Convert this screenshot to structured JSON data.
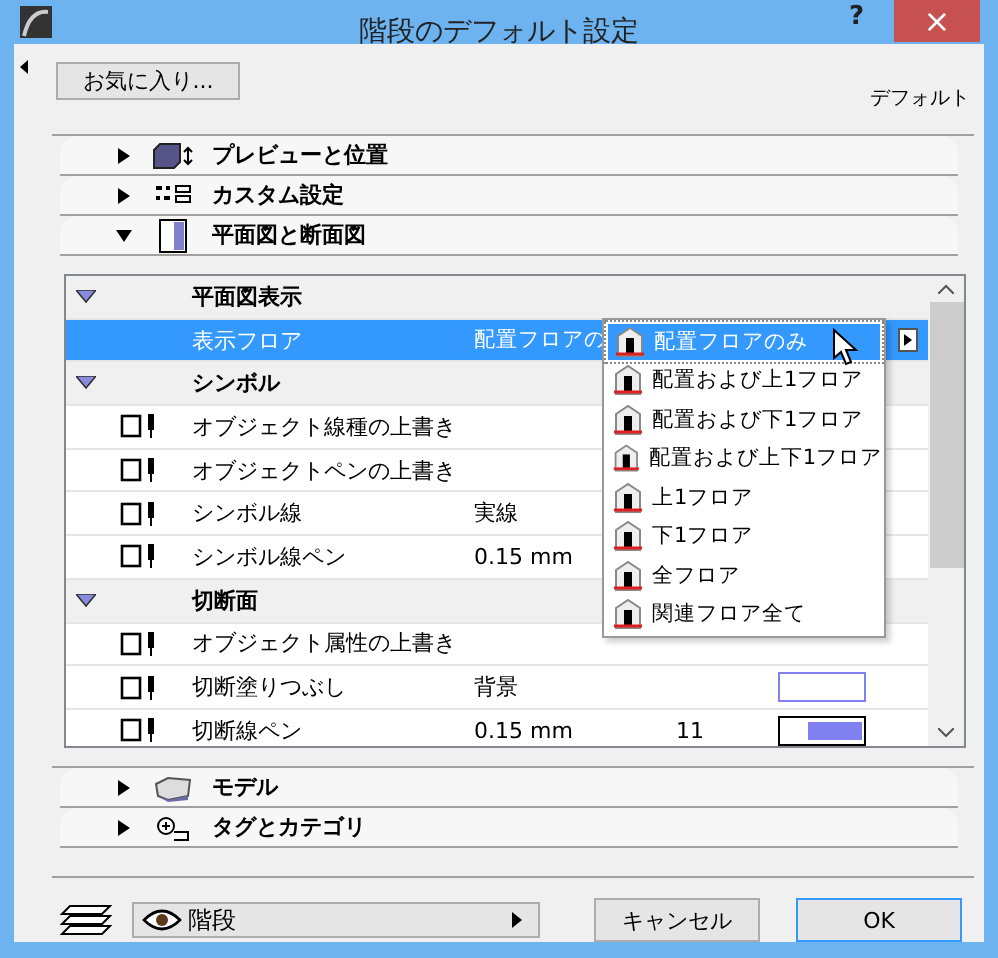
{
  "window": {
    "title": "階段のデフォルト設定",
    "help": "?",
    "close": "×"
  },
  "favorites_button": "お気に入り...",
  "default_label": "デフォルト",
  "sections": [
    {
      "label": "プレビューと位置",
      "expanded": false
    },
    {
      "label": "カスタム設定",
      "expanded": false
    },
    {
      "label": "平面図と断面図",
      "expanded": true
    }
  ],
  "table": {
    "rows": [
      {
        "kind": "group",
        "label": "平面図表示",
        "selected": false
      },
      {
        "kind": "plain",
        "label": "表示フロア",
        "value": "配置フロアの",
        "selected": true
      },
      {
        "kind": "group",
        "label": "シンボル",
        "selected": false
      },
      {
        "kind": "item",
        "label": "オブジェクト線種の上書き",
        "selected": false
      },
      {
        "kind": "item",
        "label": "オブジェクトペンの上書き",
        "selected": false
      },
      {
        "kind": "item",
        "label": "シンボル線",
        "value": "実線",
        "selected": false
      },
      {
        "kind": "item",
        "label": "シンボル線ペン",
        "value": "0.15 mm",
        "selected": false
      },
      {
        "kind": "group",
        "label": "切断面",
        "selected": false
      },
      {
        "kind": "item",
        "label": "オブジェクト属性の上書き",
        "selected": false
      },
      {
        "kind": "item",
        "label": "切断塗りつぶし",
        "value": "背景",
        "swatch": {
          "kind": "outline",
          "color": "#8080f0"
        },
        "selected": false
      },
      {
        "kind": "item",
        "label": "切断線ペン",
        "value": "0.15 mm",
        "value_2": "11",
        "swatch": {
          "kind": "pen",
          "color": "#8080f0"
        },
        "selected": false
      }
    ]
  },
  "dropdown": {
    "items": [
      {
        "label": "配置フロアのみ",
        "selected": true
      },
      {
        "label": "配置および上1フロア",
        "selected": false
      },
      {
        "label": "配置および下1フロア",
        "selected": false
      },
      {
        "label": "配置および上下1フロア",
        "selected": false
      },
      {
        "label": "上1フロア",
        "selected": false
      },
      {
        "label": "下1フロア",
        "selected": false
      },
      {
        "label": "全フロア",
        "selected": false
      },
      {
        "label": "関連フロア全て",
        "selected": false
      }
    ]
  },
  "bottom_sections": [
    {
      "label": "モデル",
      "expanded": false
    },
    {
      "label": "タグとカテゴリ",
      "expanded": false
    }
  ],
  "footer": {
    "layer_dropdown": "階段",
    "cancel_button": "キャンセル",
    "ok_button": "OK"
  }
}
